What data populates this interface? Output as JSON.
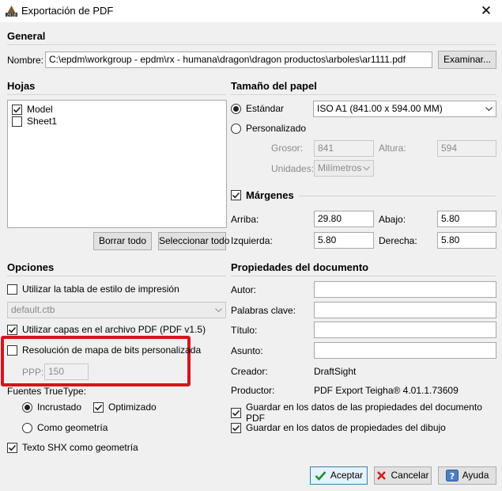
{
  "window": {
    "title": "Exportación de PDF",
    "close": "✕"
  },
  "general": {
    "heading": "General",
    "name_label": "Nombre:",
    "name_value": "C:\\epdm\\workgroup - epdm\\rx - humana\\dragon\\dragon productos\\arboles\\ar1111.pdf",
    "browse_button": "Examinar..."
  },
  "sheets": {
    "heading": "Hojas",
    "items": [
      {
        "label": "Model",
        "checked": true
      },
      {
        "label": "Sheet1",
        "checked": false
      }
    ],
    "clear_all": "Borrar todo",
    "select_all": "Seleccionar todo"
  },
  "paper": {
    "heading": "Tamaño del papel",
    "standard_label": "Estándar",
    "standard_value": "ISO A1 (841.00 x 594.00 MM)",
    "custom_label": "Personalizado",
    "width_label": "Grosor:",
    "width_value": "841",
    "height_label": "Altura:",
    "height_value": "594",
    "units_label": "Unidades:",
    "units_value": "Milímetros"
  },
  "margins": {
    "heading": "Márgenes",
    "top_label": "Arriba:",
    "top_value": "29.80",
    "bottom_label": "Abajo:",
    "bottom_value": "5.80",
    "left_label": "Izquierda:",
    "left_value": "5.80",
    "right_label": "Derecha:",
    "right_value": "5.80"
  },
  "options": {
    "heading": "Opciones",
    "use_style_table": "Utilizar la tabla de estilo de impresión",
    "style_table_value": "default.ctb",
    "use_pdf_layers": "Utilizar capas en el archivo PDF (PDF v1.5)",
    "custom_bitmap": "Resolución de mapa de bits personalizada",
    "dpi_label": "PPP:",
    "dpi_value": "150",
    "truetype_label": "Fuentes TrueType:",
    "embedded": "Incrustado",
    "optimized": "Optimizado",
    "as_geometry": "Como geometría",
    "shx_as_geometry": "Texto SHX como geometría"
  },
  "doc_props": {
    "heading": "Propiedades del documento",
    "author_label": "Autor:",
    "keywords_label": "Palabras clave:",
    "title_label": "Título:",
    "subject_label": "Asunto:",
    "creator_label": "Creador:",
    "creator_value": "DraftSight",
    "producer_label": "Productor:",
    "producer_value": "PDF Export Teigha® 4.01.1.73609",
    "save_doc_props": "Guardar en los datos de las propiedades del documento PDF",
    "save_drawing_props": "Guardar en los datos de propiedades del dibujo"
  },
  "footer": {
    "accept": "Aceptar",
    "cancel": "Cancelar",
    "help": "Ayuda"
  },
  "colors": {
    "highlight": "#d6141c",
    "accept_check": "#1f8f2a",
    "cancel_x": "#d01a1a",
    "help_icon": "#4a7fc1"
  }
}
